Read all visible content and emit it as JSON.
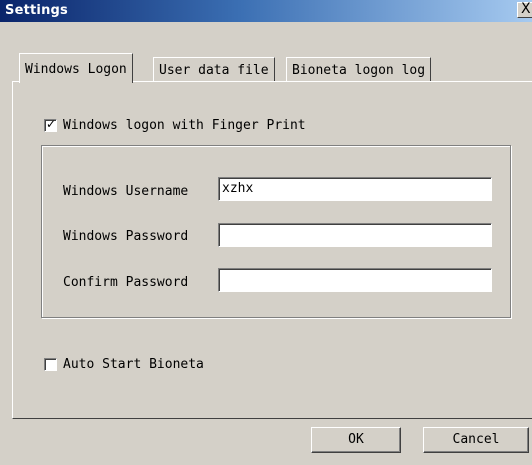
{
  "window": {
    "title": "Settings",
    "close_glyph": "X"
  },
  "tabs": [
    {
      "label": "Windows Logon",
      "active": true
    },
    {
      "label": "User data file",
      "active": false
    },
    {
      "label": "Bioneta logon log",
      "active": false
    }
  ],
  "logon": {
    "finger_print_checkbox": {
      "label": "Windows logon with Finger Print",
      "checked": true
    },
    "fields": {
      "username": {
        "label": "Windows Username",
        "value": "xzhx"
      },
      "password": {
        "label": "Windows Password",
        "value": ""
      },
      "confirm": {
        "label": "Confirm Password",
        "value": ""
      }
    },
    "auto_start_checkbox": {
      "label": "Auto Start Bioneta",
      "checked": false
    }
  },
  "buttons": {
    "ok": "OK",
    "cancel": "Cancel"
  },
  "colors": {
    "face": "#d4d0c8",
    "titlebar_start": "#0a246a",
    "titlebar_end": "#a6caf0"
  }
}
